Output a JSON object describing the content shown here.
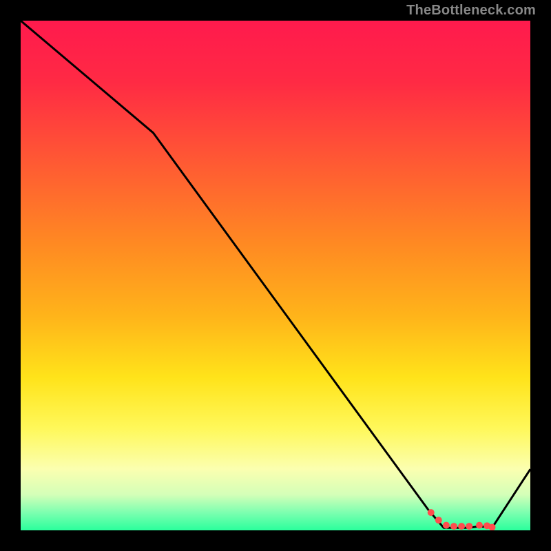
{
  "watermark": "TheBottleneck.com",
  "chart_data": {
    "type": "line",
    "title": "",
    "xlabel": "",
    "ylabel": "",
    "xlim": [
      0,
      100
    ],
    "ylim": [
      0,
      100
    ],
    "x": [
      0,
      26,
      80,
      83,
      88,
      90,
      92.5,
      100
    ],
    "values": [
      100,
      78,
      4,
      0.5,
      0.5,
      0.8,
      0.5,
      12
    ],
    "marker_points": [
      {
        "x": 80.5,
        "y": 3.5
      },
      {
        "x": 82,
        "y": 2.0
      },
      {
        "x": 83.5,
        "y": 1.0
      },
      {
        "x": 85,
        "y": 0.8
      },
      {
        "x": 86.5,
        "y": 0.8
      },
      {
        "x": 88,
        "y": 0.8
      },
      {
        "x": 90,
        "y": 1.0
      },
      {
        "x": 91.5,
        "y": 0.9
      },
      {
        "x": 92.5,
        "y": 0.6
      }
    ],
    "gradient_stops": [
      {
        "offset": 0.0,
        "color": "#ff1a4d"
      },
      {
        "offset": 0.12,
        "color": "#ff2a44"
      },
      {
        "offset": 0.28,
        "color": "#ff5a33"
      },
      {
        "offset": 0.44,
        "color": "#ff8a22"
      },
      {
        "offset": 0.58,
        "color": "#ffb41a"
      },
      {
        "offset": 0.7,
        "color": "#ffe31a"
      },
      {
        "offset": 0.8,
        "color": "#fff85a"
      },
      {
        "offset": 0.88,
        "color": "#fbffb0"
      },
      {
        "offset": 0.93,
        "color": "#d4ffb8"
      },
      {
        "offset": 0.965,
        "color": "#7dffb0"
      },
      {
        "offset": 1.0,
        "color": "#2aff9c"
      }
    ],
    "line_color": "#000000",
    "marker_color": "#ff4d4d"
  }
}
